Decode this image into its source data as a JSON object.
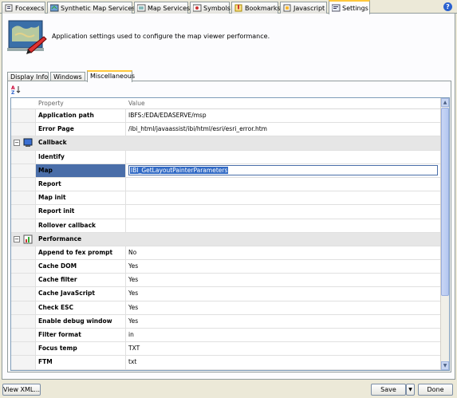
{
  "tabs": [
    {
      "label": "Focexecs",
      "icon": "focexec-icon"
    },
    {
      "label": "Synthetic Map Services",
      "icon": "map-services-icon"
    },
    {
      "label": "Map Services",
      "icon": "map-icon"
    },
    {
      "label": "Symbols",
      "icon": "symbols-icon"
    },
    {
      "label": "Bookmarks",
      "icon": "bookmarks-icon"
    },
    {
      "label": "Javascript",
      "icon": "javascript-icon"
    },
    {
      "label": "Settings",
      "icon": "settings-icon",
      "active": true
    }
  ],
  "help": "?",
  "description": "Application settings used to configure the map viewer performance.",
  "inner_tabs": [
    "Display Info",
    "Windows",
    "Miscellaneous"
  ],
  "grid": {
    "headers": {
      "property": "Property",
      "value": "Value"
    },
    "rows": [
      {
        "name": "Application path",
        "value": "IBFS:/EDA/EDASERVE/msp"
      },
      {
        "name": "Error Page",
        "value": "/ibi_html/javaassist/ibi/html/esri/esri_error.htm"
      },
      {
        "name": "Callback",
        "value": "",
        "group": true,
        "icon": "callback-icon"
      },
      {
        "name": "Identify",
        "value": ""
      },
      {
        "name": "Map",
        "value": "IBI_GetLayoutPainterParameters",
        "selected": true
      },
      {
        "name": "Report",
        "value": ""
      },
      {
        "name": "Map init",
        "value": ""
      },
      {
        "name": "Report init",
        "value": ""
      },
      {
        "name": "Rollover callback",
        "value": ""
      },
      {
        "name": "Performance",
        "value": "",
        "group": true,
        "icon": "performance-icon"
      },
      {
        "name": "Append to fex prompt",
        "value": "No"
      },
      {
        "name": "Cache DOM",
        "value": "Yes"
      },
      {
        "name": "Cache filter",
        "value": "Yes"
      },
      {
        "name": "Cache JavaScript",
        "value": "Yes"
      },
      {
        "name": "Check ESC",
        "value": "Yes"
      },
      {
        "name": "Enable debug window",
        "value": "Yes"
      },
      {
        "name": "Filter format",
        "value": "in"
      },
      {
        "name": "Focus temp",
        "value": "TXT"
      },
      {
        "name": "FTM",
        "value": "txt"
      }
    ]
  },
  "buttons": {
    "view_xml": "View XML...",
    "save": "Save",
    "done": "Done"
  }
}
